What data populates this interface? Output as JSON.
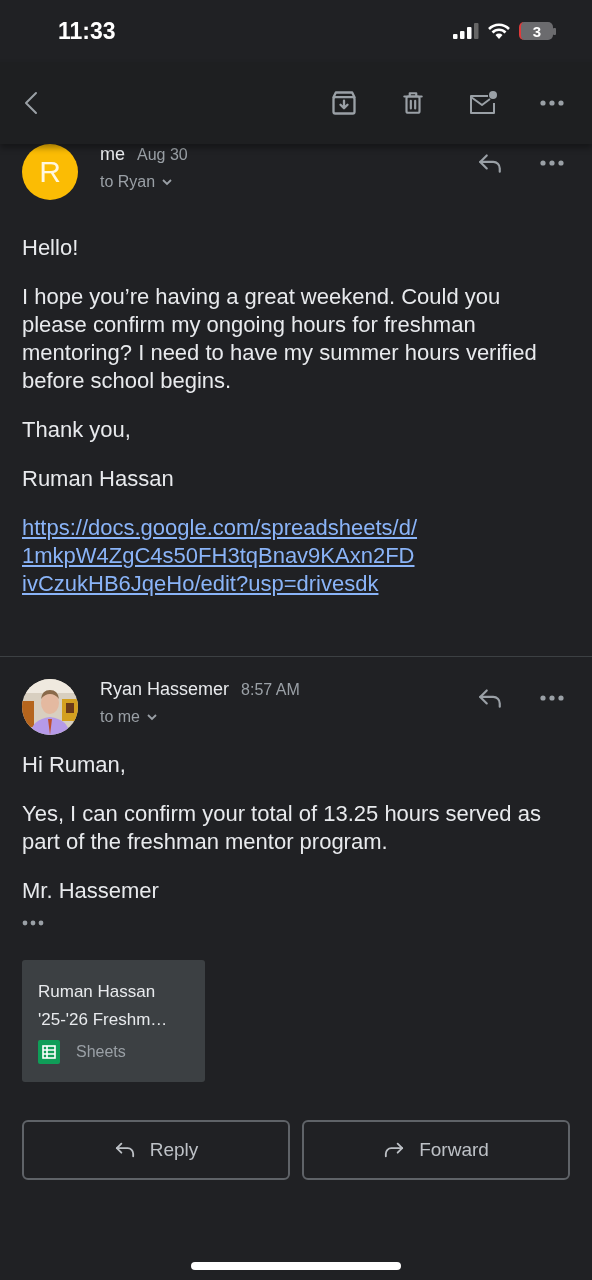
{
  "status_bar": {
    "time": "11:33",
    "battery": "3"
  },
  "messages": [
    {
      "sender": "me",
      "time": "Aug 30",
      "recipient": "to Ryan",
      "avatar": {
        "kind": "letter",
        "letter": "R",
        "color": "#fbbc04"
      },
      "paragraphs": [
        "Hello!",
        "I hope you’re having a great weekend. Could you please confirm my ongoing hours for freshman mentoring? I need to have my summer hours verified before school begins.",
        "Thank you,",
        "Ruman Hassan"
      ],
      "link_lines": [
        "https://docs.google.com/spreadsheets/d/",
        "1mkpW4ZgC4s50FH3tqBnav9KAxn2FD",
        "ivCzukHB6JqeHo/edit?usp=drivesdk"
      ],
      "trimmed": false
    },
    {
      "sender": "Ryan Hassemer",
      "time": "8:57 AM",
      "recipient": "to me",
      "avatar": {
        "kind": "picture"
      },
      "paragraphs": [
        "Hi Ruman,",
        "Yes, I can confirm your total of 13.25 hours served as part of the freshman mentor program.",
        "Mr. Hassemer"
      ],
      "trimmed": true,
      "attachment": {
        "title_lines": [
          "Ruman Hassan",
          "'25-'26 Freshm…"
        ],
        "app": "Sheets"
      }
    }
  ],
  "actions": [
    {
      "kind": "reply",
      "label": "Reply"
    },
    {
      "kind": "forward",
      "label": "Forward"
    }
  ]
}
